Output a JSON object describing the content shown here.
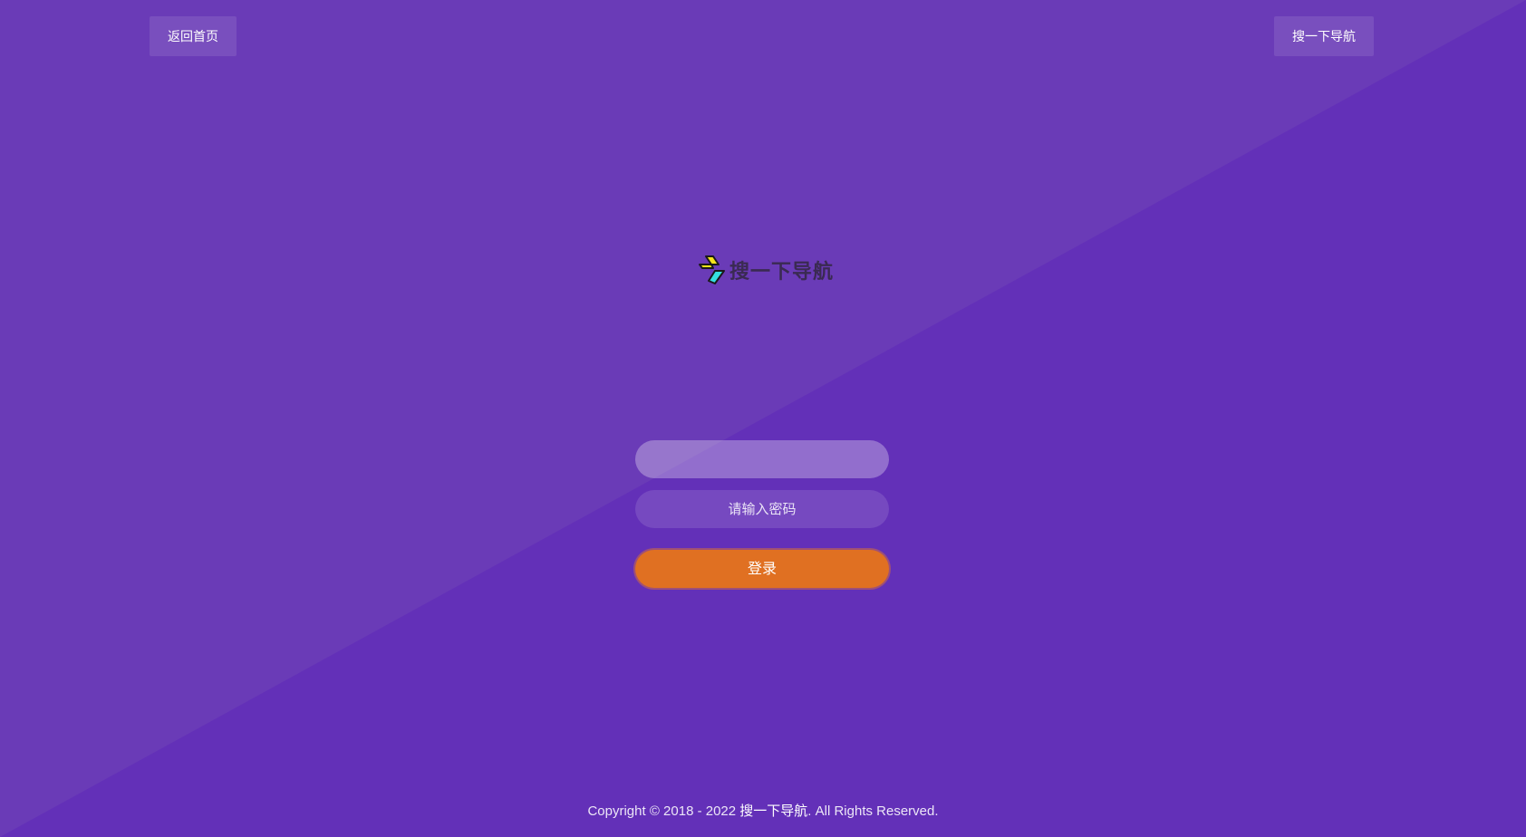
{
  "header": {
    "home_button": "返回首页",
    "site_button": "搜一下导航"
  },
  "logo": {
    "text": "搜一下导航",
    "icon": "lightning-bolt-logo-icon"
  },
  "login_form": {
    "username_placeholder": "",
    "username_value": "",
    "password_placeholder": "请输入密码",
    "submit_label": "登录"
  },
  "footer": {
    "prefix": "Copyright © 2018 - 2022 ",
    "site_link": "搜一下导航",
    "suffix": ". All Rights Reserved."
  },
  "colors": {
    "background": "#6330b8",
    "background_light": "#6a3bb7",
    "login_button": "#e07022"
  }
}
